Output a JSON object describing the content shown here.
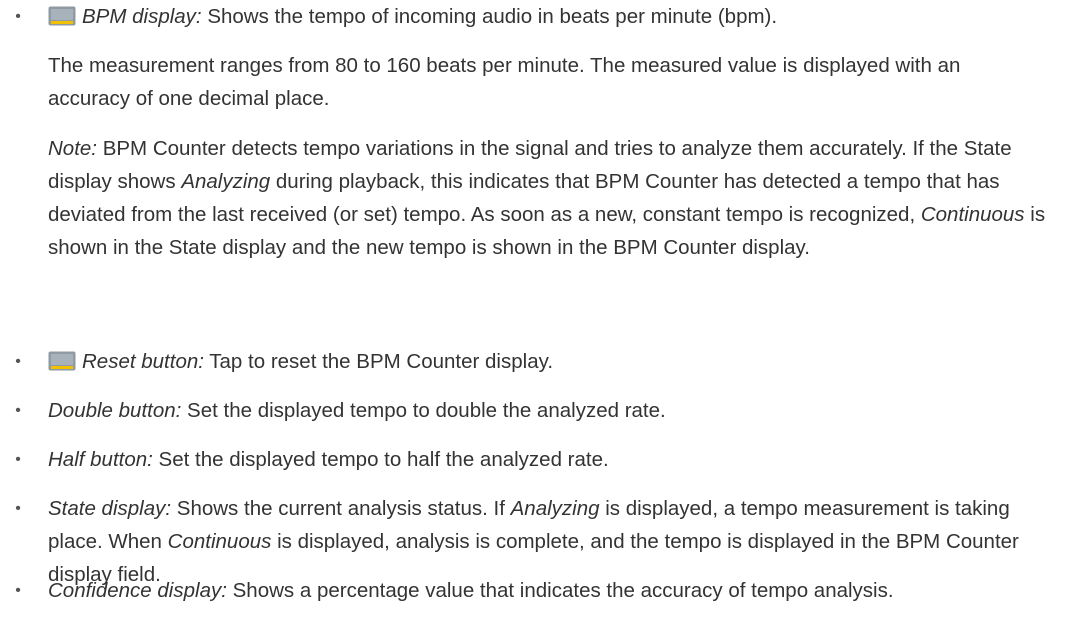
{
  "items": {
    "bpm_display": {
      "term": "BPM display:",
      "text": " Shows the tempo of incoming audio in beats per minute (bpm)."
    },
    "bpm_range": {
      "text": "The measurement ranges from 80 to 160 beats per minute. The measured value is displayed with an accuracy of one decimal place."
    },
    "bpm_note": {
      "note_label": "Note:",
      "part1": " BPM Counter detects tempo variations in the signal and tries to analyze them accurately. If the State display shows ",
      "analyzing": "Analyzing",
      "part2": " during playback, this indicates that BPM Counter has detected a tempo that has deviated from the last received (or set) tempo. As soon as a new, constant tempo is recognized, ",
      "continuous": "Continuous",
      "part3": " is shown in the State display and the new tempo is shown in the BPM Counter display."
    },
    "reset_button": {
      "term": "Reset button:",
      "text": " Tap to reset the BPM Counter display."
    },
    "double_button": {
      "term": "Double button:",
      "text": " Set the displayed tempo to double the analyzed rate."
    },
    "half_button": {
      "term": "Half button:",
      "text": " Set the displayed tempo to half the analyzed rate."
    },
    "state_display": {
      "term": "State display:",
      "part1": " Shows the current analysis status. If ",
      "analyzing": "Analyzing",
      "part2": " is displayed, a tempo measurement is taking place. When ",
      "continuous": "Continuous",
      "part3": " is displayed, analysis is complete, and the tempo is displayed in the BPM Counter display field."
    },
    "confidence_display": {
      "term": "Confidence display:",
      "text": " Shows a percentage value that indicates the accuracy of tempo analysis."
    }
  },
  "bullet_char": "•",
  "icons": {
    "callout": "callout-tag-icon"
  },
  "colors": {
    "text": "#333333",
    "icon_fill": "#8f9aa3",
    "icon_accent": "#f2c200"
  }
}
